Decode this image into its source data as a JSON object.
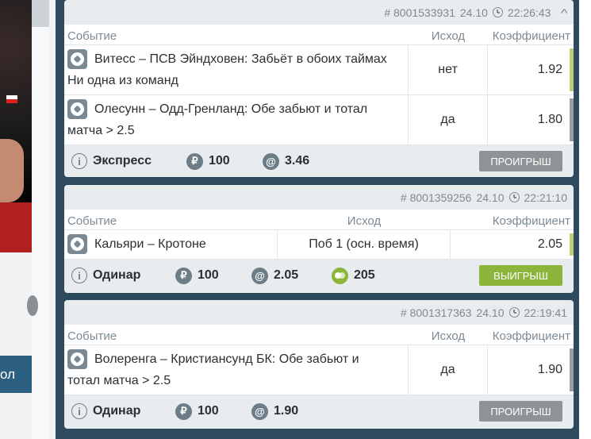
{
  "background_fragment": {
    "button_text": "ол"
  },
  "bets": [
    {
      "id": "# 8001533931",
      "date": "24.10",
      "time": "22:26:43",
      "columns": {
        "event": "Событие",
        "outcome": "Исход",
        "coef": "Коэффициент"
      },
      "rows": [
        {
          "event_line1": "Витесс – ПСВ Эйндховен: Забьёт в обоих таймах",
          "event_line2": "Ни одна из команд",
          "outcome": "нет",
          "coef": "1.92"
        },
        {
          "event_line1": "Олесунн – Одд-Гренланд: Обе забьют и тотал",
          "event_line2": "матча > 2.5",
          "outcome": "да",
          "coef": "1.80"
        }
      ],
      "type": "Экспресс",
      "stake": "100",
      "total_coef": "3.46",
      "status": "ПРОИГРЫШ",
      "status_color": "#8f9396"
    },
    {
      "id": "# 8001359256",
      "date": "24.10",
      "time": "22:21:10",
      "columns": {
        "event": "Событие",
        "outcome": "Исход",
        "coef": "Коэффициент"
      },
      "rows": [
        {
          "event_line1": "Кальяри – Кротоне",
          "event_line2": "",
          "outcome": "Поб 1 (осн. время)",
          "coef": "2.05"
        }
      ],
      "type": "Одинар",
      "stake": "100",
      "total_coef": "2.05",
      "win": "205",
      "status": "ВЫИГРЫШ",
      "status_color": "#8cb53b"
    },
    {
      "id": "# 8001317363",
      "date": "24.10",
      "time": "22:19:41",
      "columns": {
        "event": "Событие",
        "outcome": "Исход",
        "coef": "Коэффициент"
      },
      "rows": [
        {
          "event_line1": "Волеренга – Кристиансунд БК: Обе забьют и",
          "event_line2": "тотал матча > 2.5",
          "outcome": "да",
          "coef": "1.90"
        }
      ],
      "type": "Одинар",
      "stake": "100",
      "total_coef": "1.90",
      "status": "ПРОИГРЫШ",
      "status_color": "#8f9396"
    }
  ],
  "icons": {
    "info": "i",
    "ruble": "₽",
    "at": "@",
    "chevron": "^"
  }
}
